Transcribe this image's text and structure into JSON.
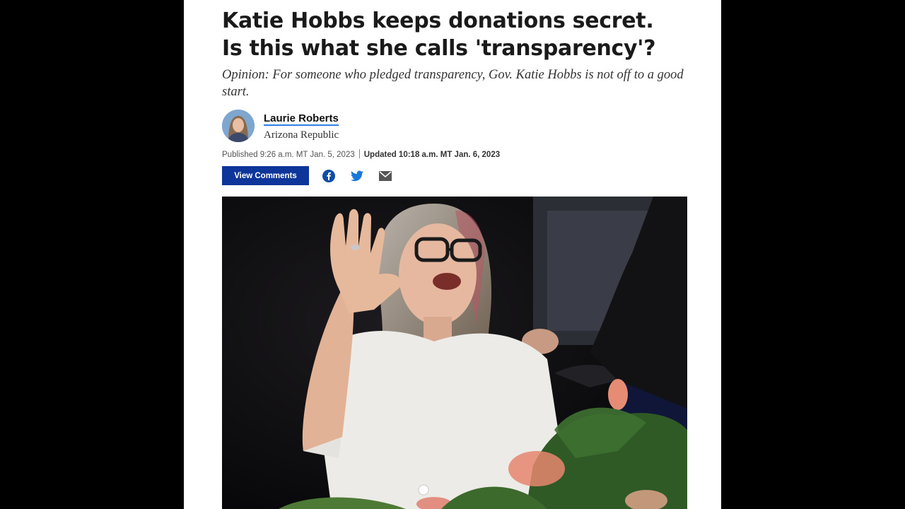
{
  "article": {
    "headline_line1": "Katie Hobbs keeps donations secret.",
    "headline_line2": "Is this what she calls 'transparency'?",
    "dek": "Opinion: For someone who pledged transparency, Gov. Katie Hobbs is not off to a good start.",
    "author": {
      "name": "Laurie Roberts",
      "organization": "Arizona Republic"
    },
    "published": "Published 9:26 a.m. MT Jan. 5, 2023",
    "updated": "Updated 10:18 a.m. MT Jan. 6, 2023"
  },
  "actions": {
    "comments_label": "View Comments",
    "share_icons": [
      "facebook-icon",
      "twitter-icon",
      "email-icon"
    ]
  },
  "colors": {
    "button_bg": "#0e3599",
    "share_icon": "#0e4da4",
    "author_underline": "#2f7ee8",
    "letterbox": "#000000"
  }
}
